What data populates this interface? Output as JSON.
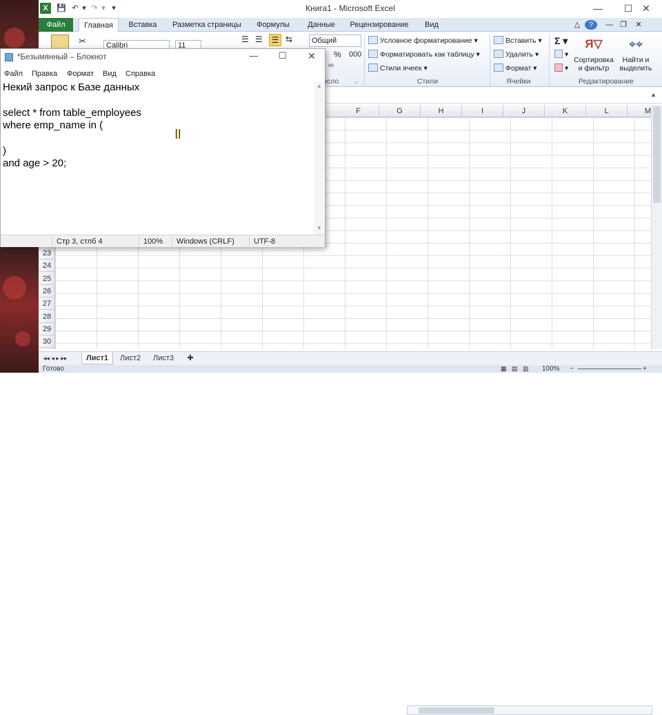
{
  "excel": {
    "title": "Книга1 - Microsoft Excel",
    "tabs": [
      "Файл",
      "Главная",
      "Вставка",
      "Разметка страницы",
      "Формулы",
      "Данные",
      "Рецензирование",
      "Вид"
    ],
    "ribbon": {
      "font_name": "Calibri",
      "font_size": "11",
      "number_format": "Общий",
      "percent": "%",
      "thousands": "000",
      "group_number": "исло",
      "styles": {
        "conditional": "Условное форматирование",
        "format_table": "Форматировать как таблицу",
        "cell_styles": "Стили ячеек",
        "label": "Стили"
      },
      "cells": {
        "insert": "Вставить",
        "delete": "Удалить",
        "format": "Формат",
        "label": "Ячейки"
      },
      "editing": {
        "sigma": "Σ",
        "sort_filter": "Сортировка и фильтр",
        "find_select": "Найти и выделить",
        "label": "Редактирование"
      }
    },
    "columns": [
      "F",
      "G",
      "H",
      "I",
      "J",
      "K",
      "L",
      "M"
    ],
    "rows": [
      "23",
      "24",
      "25",
      "26",
      "27",
      "28",
      "29",
      "30"
    ],
    "sheets": [
      "Лист1",
      "Лист2",
      "Лист3"
    ],
    "status": {
      "ready": "Готово",
      "zoom": "100%"
    }
  },
  "notepad": {
    "title": "*Безымянный – Блокнот",
    "menu": [
      "Файл",
      "Правка",
      "Формат",
      "Вид",
      "Справка"
    ],
    "text": "Некий запрос к Базе данных\n\nselect * from table_employees\nwhere emp_name in (\n\n)\nand age > 20;",
    "status": {
      "position": "Стр 3, стлб 4",
      "zoom": "100%",
      "line_endings": "Windows (CRLF)",
      "encoding": "UTF-8"
    }
  },
  "colors": {
    "excel_green": "#2a7d3a",
    "ribbon_bg": "#dfe9f5"
  }
}
